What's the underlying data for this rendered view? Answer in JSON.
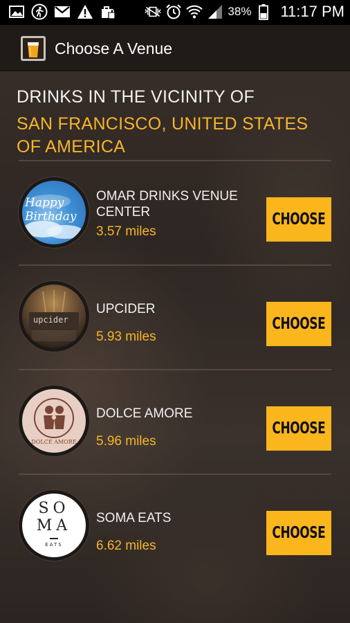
{
  "status_bar": {
    "battery_percent": "38%",
    "time": "11:17 PM",
    "icons": [
      "gallery-icon",
      "running-icon",
      "gmail-icon",
      "warning-icon",
      "briefcase-lock-icon",
      "vibrate-icon",
      "alarm-icon",
      "wifi-icon",
      "signal-icon",
      "battery-icon"
    ]
  },
  "action_bar": {
    "title": "Choose A Venue",
    "icon": "beer-glass-icon"
  },
  "header": {
    "line1": "DRINKS IN THE VICINITY OF",
    "location": "SAN FRANCISCO, UNITED STATES OF AMERICA"
  },
  "venues": [
    {
      "name": "OMAR DRINKS VENUE CENTER",
      "distance": "3.57 miles",
      "button": "CHOOSE",
      "avatar_text": "Happy Birthday"
    },
    {
      "name": "UPCIDER",
      "distance": "5.93 miles",
      "button": "CHOOSE",
      "avatar_text": "upcider"
    },
    {
      "name": "DOLCE AMORE",
      "distance": "5.96 miles",
      "button": "CHOOSE",
      "avatar_text": "DOLCE AMORE"
    },
    {
      "name": "SOMA EATS",
      "distance": "6.62 miles",
      "button": "CHOOSE",
      "avatar_text": [
        "SO",
        "MA",
        "EATS"
      ]
    }
  ],
  "colors": {
    "accent": "#f6b52b",
    "button": "#fbb61d",
    "action_bar": "#1e1b19"
  }
}
